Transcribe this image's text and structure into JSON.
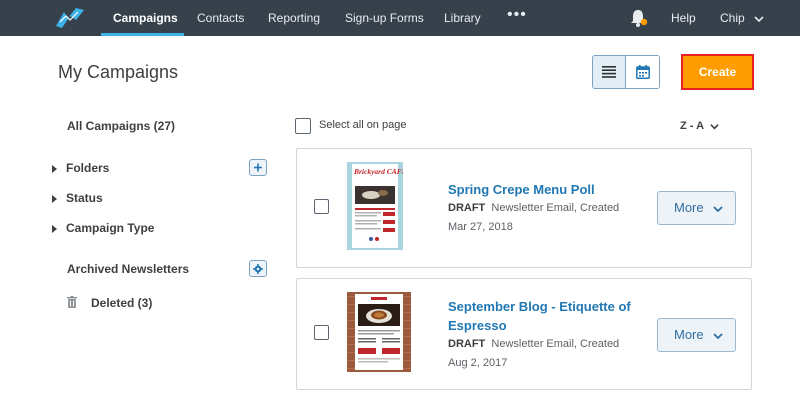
{
  "nav": {
    "items": [
      "Campaigns",
      "Contacts",
      "Reporting",
      "Sign-up Forms",
      "Library"
    ],
    "more": "•••",
    "help": "Help",
    "user": "Chip"
  },
  "header": {
    "title": "My Campaigns",
    "create_label": "Create"
  },
  "sidebar": {
    "all_campaigns": "All Campaigns (27)",
    "folders": "Folders",
    "status": "Status",
    "campaign_type": "Campaign Type",
    "archived": "Archived Newsletters",
    "deleted": "Deleted (3)"
  },
  "list": {
    "select_all": "Select all on page",
    "sort": "Z - A",
    "campaigns": [
      {
        "title": "Spring Crepe Menu Poll",
        "status": "DRAFT",
        "meta": "Newsletter Email, Created",
        "date": "Mar 27, 2018",
        "thumb_text": "Brickyard CAFE",
        "more_label": "More"
      },
      {
        "title_line1": "September Blog - Etiquette of",
        "title_line2": "Espresso",
        "status": "DRAFT",
        "meta": "Newsletter Email, Created",
        "date": "Aug 2, 2017",
        "more_label": "More"
      }
    ]
  },
  "colors": {
    "nav_bg": "#36414c",
    "nav_active_underline": "#3db2e8",
    "create_bg": "#ff9d00",
    "create_border": "#e62222",
    "link": "#2178b4"
  },
  "icons": {
    "logo": "constant-contact-logo",
    "bell": "bell-icon",
    "list_view": "list-view-icon",
    "calendar_view": "calendar-icon",
    "plus": "plus-icon",
    "gear": "gear-icon",
    "trash": "trash-icon"
  }
}
